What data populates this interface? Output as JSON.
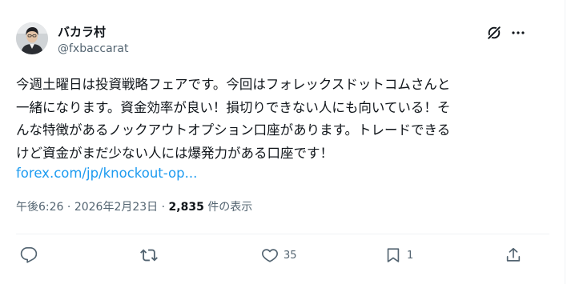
{
  "author": {
    "display_name": "バカラ村",
    "handle": "@fxbaccarat"
  },
  "icons": {
    "grok": "grok-icon",
    "more": "more-icon",
    "reply": "reply-icon",
    "repost": "repost-icon",
    "like": "heart-icon",
    "bookmark": "bookmark-icon",
    "share": "share-icon"
  },
  "post": {
    "text": "今週土曜日は投資戦略フェアです。今回はフォレックスドットコムさんと\n一緒になります。資金効率が良い！損切りできない人にも向いている！そ\nんな特徴があるノックアウトオプション口座があります。トレードできる\nけど資金がまだ少ない人には爆発力がある口座です！",
    "link_text": "forex.com/jp/knockout-op..."
  },
  "meta": {
    "time": "午後6:26",
    "separator": "·",
    "date": "2026年2月23日",
    "views_count": "2,835",
    "views_label": "件の表示"
  },
  "actions": {
    "reply_count": "",
    "repost_count": "",
    "like_count": "35",
    "bookmark_count": "1"
  },
  "colors": {
    "text": "#0f1419",
    "secondary": "#536471",
    "link": "#1d9bf0",
    "divider": "#eff3f4"
  }
}
